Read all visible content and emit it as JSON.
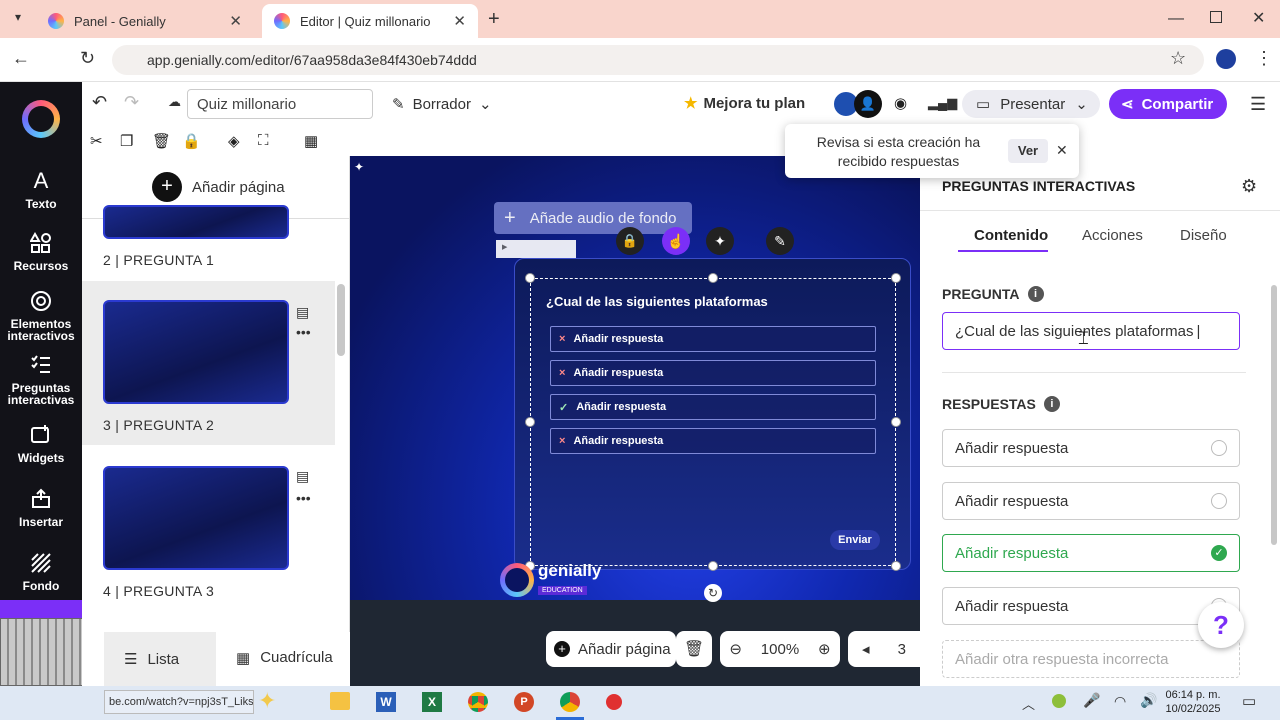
{
  "browser": {
    "tabs": [
      {
        "label": "Panel - Genially"
      },
      {
        "label": "Editor | Quiz millonario"
      }
    ],
    "url": "app.genially.com/editor/67aa958da3e84f430eb74ddd"
  },
  "nav": [
    {
      "label": "Texto",
      "icon": "text-icon"
    },
    {
      "label": "Recursos",
      "icon": "resources-icon"
    },
    {
      "label": "Elementos interactivos",
      "icon": "interactive-elements-icon"
    },
    {
      "label": "Preguntas interactivas",
      "icon": "interactive-questions-icon"
    },
    {
      "label": "Widgets",
      "icon": "widgets-icon"
    },
    {
      "label": "Insertar",
      "icon": "insert-icon"
    },
    {
      "label": "Fondo",
      "icon": "background-icon"
    }
  ],
  "toolbar": {
    "title": "Quiz millonario",
    "status": "Borrador",
    "upgrade": "Mejora tu plan",
    "present": "Presentar",
    "share": "Compartir"
  },
  "notice": {
    "text": "Revisa si esta creación ha recibido respuestas",
    "action": "Ver"
  },
  "pages": {
    "add_label": "Añadir página",
    "items": [
      {
        "label": "2 |  PREGUNTA 1"
      },
      {
        "label": "3 |  PREGUNTA 2"
      },
      {
        "label": "4 |  PREGUNTA 3"
      }
    ],
    "view_list": "Lista",
    "view_grid": "Cuadrícula"
  },
  "canvas": {
    "audio_btn": "Añade audio de fondo",
    "question": "¿Cual de las siguientes plataformas",
    "answers": [
      "Añadir respuesta",
      "Añadir respuesta",
      "Añadir respuesta",
      "Añadir respuesta"
    ],
    "send": "Enviar",
    "brand": "genially",
    "brand_sub": "EDUCATION",
    "add_page": "Añadir página",
    "zoom": "100%",
    "page_num": "3"
  },
  "panel": {
    "title": "PREGUNTAS INTERACTIVAS",
    "tabs": [
      "Contenido",
      "Acciones",
      "Diseño"
    ],
    "question_label": "PREGUNTA",
    "question_value": "¿Cual de las siguientes plataformas",
    "answers_label": "RESPUESTAS",
    "answers": [
      {
        "text": "Añadir respuesta",
        "correct": false
      },
      {
        "text": "Añadir respuesta",
        "correct": false
      },
      {
        "text": "Añadir respuesta",
        "correct": true
      },
      {
        "text": "Añadir respuesta",
        "correct": false
      }
    ],
    "add_incorrect": "Añadir otra respuesta incorrecta"
  },
  "taskbar": {
    "tooltip": "be.com/watch?v=npj3sT_Liks",
    "time": "06:14 p. m.",
    "date": "10/02/2025"
  },
  "colors": {
    "accent": "#7b2ff7",
    "brand": "#5b2bd8",
    "correct": "#2fa84f"
  }
}
